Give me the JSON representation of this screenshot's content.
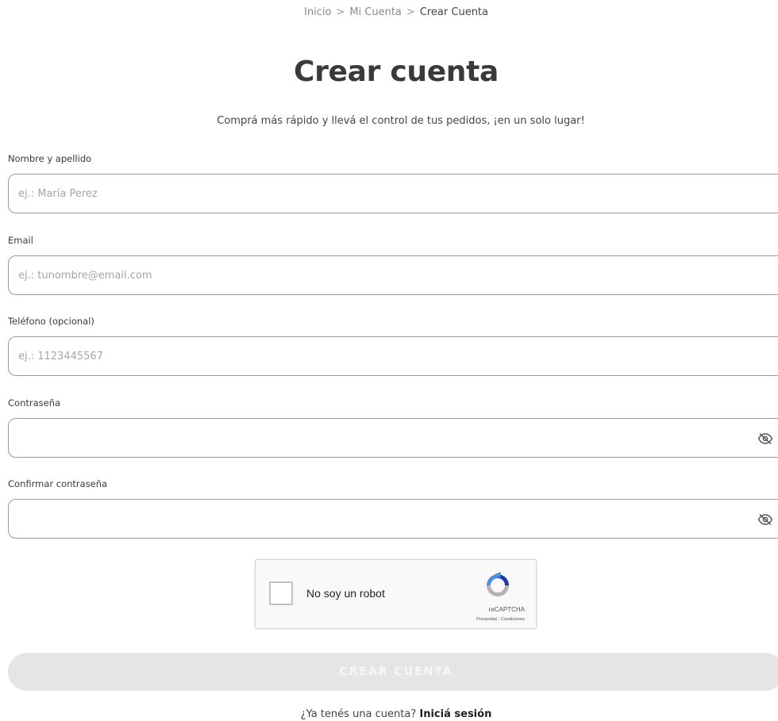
{
  "breadcrumb": {
    "items": [
      "Inicio",
      "Mi Cuenta",
      "Crear Cuenta"
    ],
    "separator": ">"
  },
  "page": {
    "title": "Crear cuenta",
    "subtitle": "Comprá más rápido y llevá el control de tus pedidos, ¡en un solo lugar!"
  },
  "form": {
    "name": {
      "label": "Nombre y apellido",
      "placeholder": "ej.: María Perez"
    },
    "email": {
      "label": "Email",
      "placeholder": "ej.: tunombre@email.com"
    },
    "phone": {
      "label": "Teléfono (opcional)",
      "placeholder": "ej.: 1123445567"
    },
    "password": {
      "label": "Contraseña",
      "placeholder": ""
    },
    "confirm_password": {
      "label": "Confirmar contraseña",
      "placeholder": ""
    }
  },
  "recaptcha": {
    "label": "No soy un robot",
    "brand": "reCAPTCHA",
    "terms": "Privacidad - Condiciones"
  },
  "submit": {
    "label": "CREAR CUENTA"
  },
  "login": {
    "prompt": "¿Ya tenés una cuenta?",
    "link": "Iniciá sesión"
  },
  "icons": {
    "password_toggle": "eye-off-icon",
    "recaptcha_logo": "recaptcha-logo-icon"
  },
  "colors": {
    "recaptcha_blue": "#4a90e2",
    "recaptcha_gray": "#b3b3b3",
    "button_disabled": "#e5e5e5"
  }
}
